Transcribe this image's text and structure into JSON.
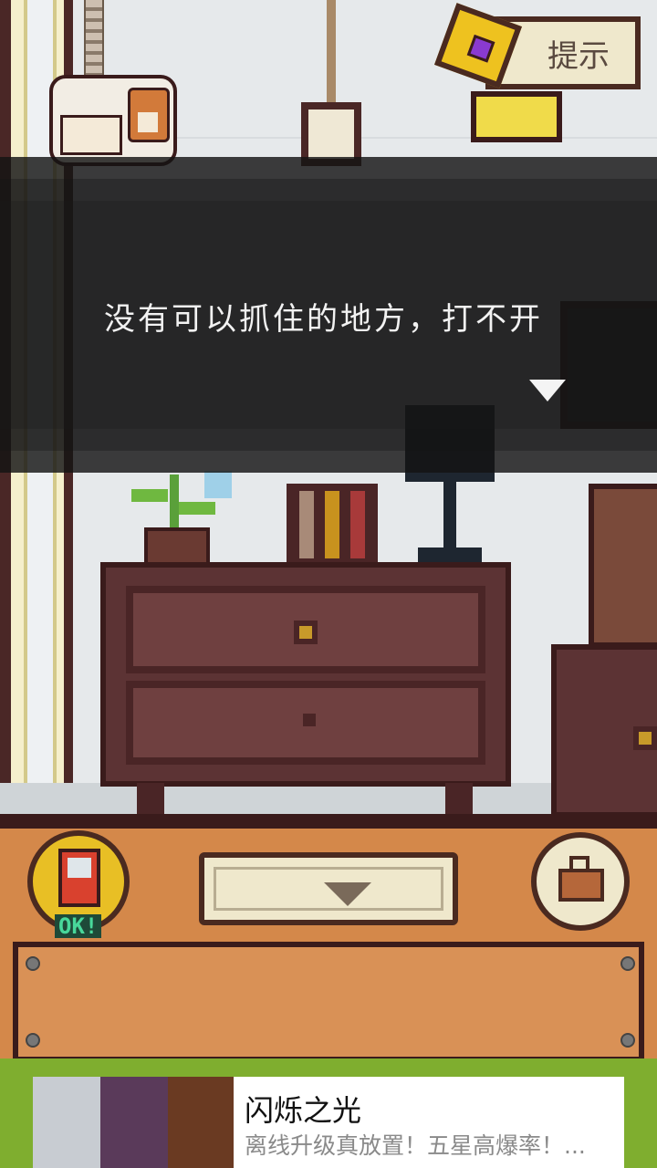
{
  "hint_button": {
    "label": "提示"
  },
  "dialog": {
    "message": "没有可以抓住的地方，打不开"
  },
  "bottom_bar": {
    "capsule_badge": "OK!"
  },
  "ad": {
    "title": "闪烁之光",
    "description": "离线升级真放置！五星高爆率！..."
  },
  "icons": {
    "hint": "hint-book-icon",
    "capsule": "capsule-machine-icon",
    "bag": "bag-icon",
    "down": "down-arrow-icon",
    "dialog_next": "dialog-next-arrow-icon"
  },
  "colors": {
    "panel_wood": "#d4884a",
    "frame_dark": "#4a2a20",
    "dialog_bg": "#141414",
    "capsule_gold": "#e8bf25",
    "ok_green": "#48d89a"
  }
}
